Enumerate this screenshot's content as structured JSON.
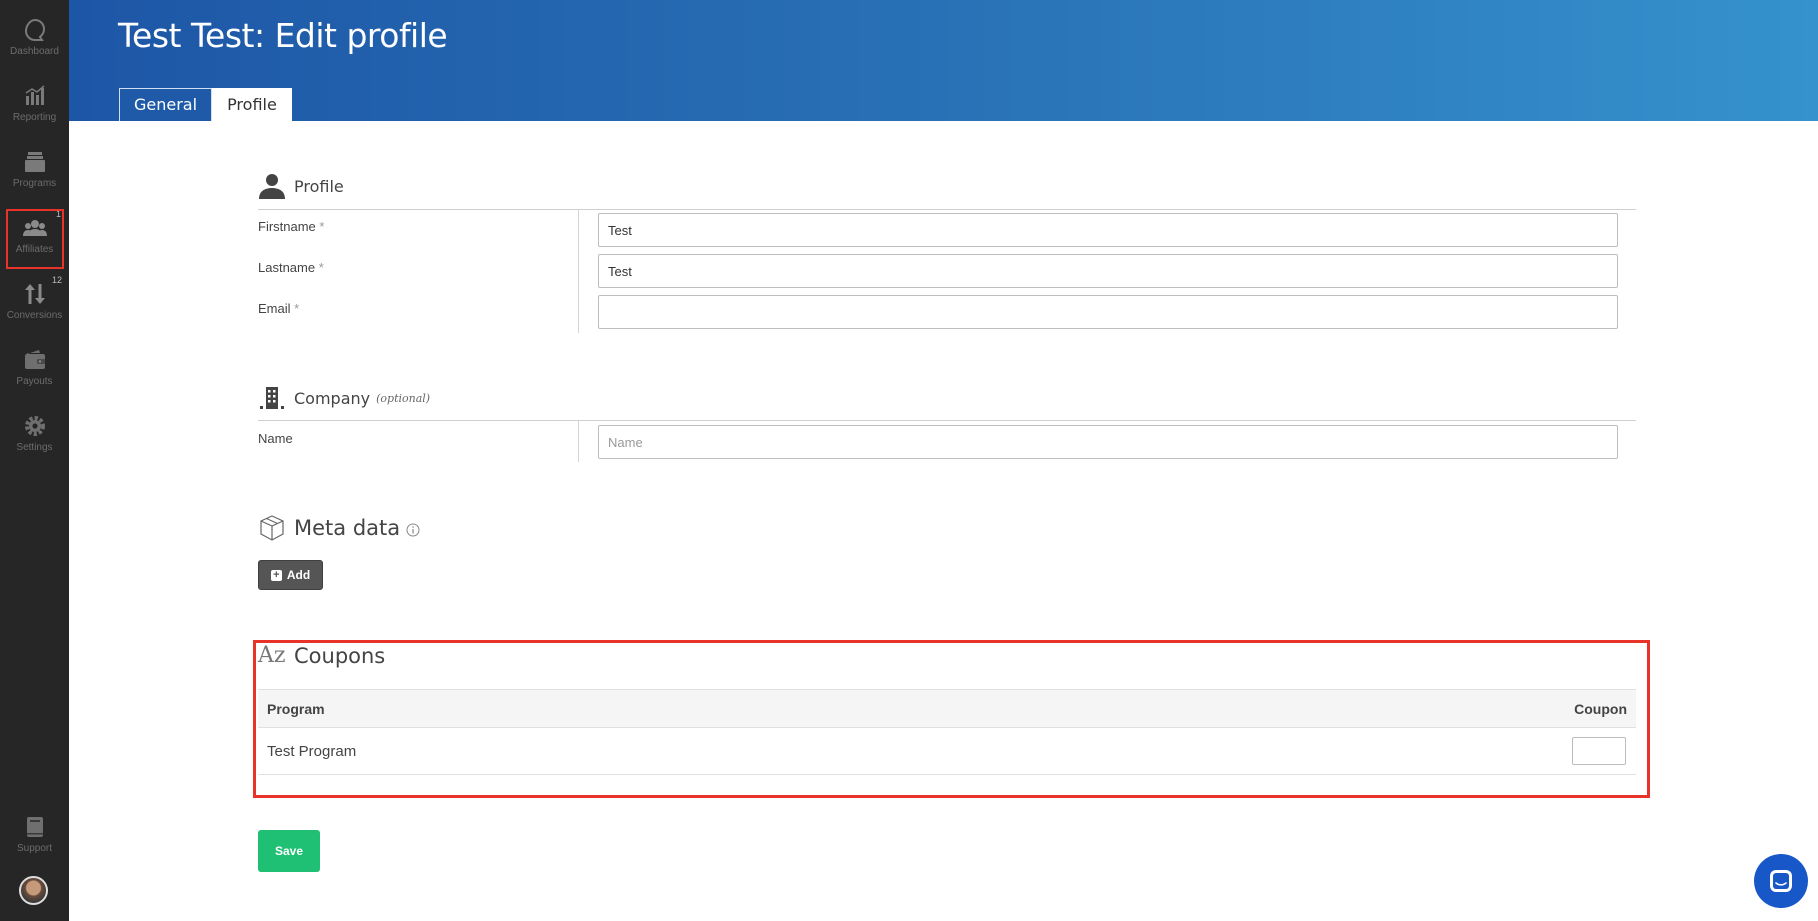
{
  "sidebar": {
    "items": [
      {
        "label": "Dashboard",
        "icon": "dashboard-icon"
      },
      {
        "label": "Reporting",
        "icon": "bar-chart-icon"
      },
      {
        "label": "Programs",
        "icon": "stack-icon"
      },
      {
        "label": "Affiliates",
        "icon": "users-icon",
        "badge": "1"
      },
      {
        "label": "Conversions",
        "icon": "arrows-updown-icon",
        "badge": "12"
      },
      {
        "label": "Payouts",
        "icon": "wallet-icon"
      },
      {
        "label": "Settings",
        "icon": "gear-icon"
      }
    ],
    "support_label": "Support"
  },
  "header": {
    "title": "Test Test: Edit profile",
    "tabs": [
      {
        "label": "General",
        "active": false
      },
      {
        "label": "Profile",
        "active": true
      }
    ]
  },
  "profile": {
    "heading": "Profile",
    "required_mark": "*",
    "fields": [
      {
        "label": "Firstname",
        "value": "Test",
        "required": true
      },
      {
        "label": "Lastname",
        "value": "Test",
        "required": true
      },
      {
        "label": "Email",
        "value": "",
        "required": true
      }
    ]
  },
  "company": {
    "heading": "Company",
    "optional_label": "(optional)",
    "name_label": "Name",
    "name_value": "",
    "name_placeholder": "Name"
  },
  "metadata": {
    "heading": "Meta data",
    "add_label": "Add"
  },
  "coupons": {
    "heading": "Coupons",
    "icon_text": "Az",
    "columns": [
      "Program",
      "Coupon"
    ],
    "rows": [
      {
        "program": "Test Program",
        "coupon": ""
      }
    ]
  },
  "actions": {
    "save_label": "Save"
  },
  "colors": {
    "sidebar_bg": "#262626",
    "header_start": "#1d56a6",
    "header_end": "#3592cc",
    "save_green": "#1fbf74",
    "highlight_red": "#e8332a"
  }
}
